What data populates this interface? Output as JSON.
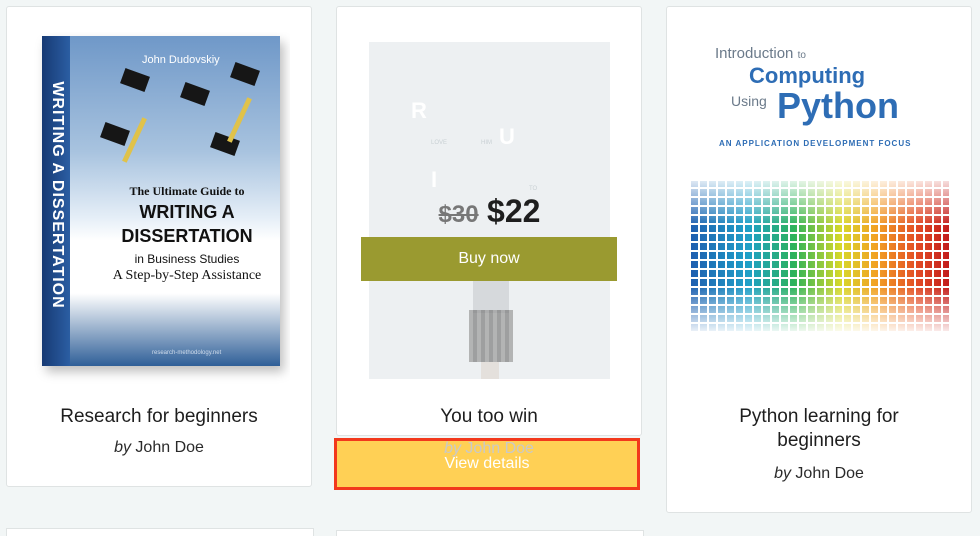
{
  "books": [
    {
      "title": "Research for beginners",
      "by": "by",
      "author": "John Doe",
      "cover": {
        "author": "John Dudovskiy",
        "spine": "WRITING A DISSERTATION",
        "line1": "The Ultimate Guide to",
        "line2": "WRITING A",
        "line3": "DISSERTATION",
        "line4": "in Business Studies",
        "line5": "A Step-by-Step Assistance",
        "url": "research-methodology.net"
      }
    },
    {
      "title": "You too win",
      "by": "by",
      "author": "John Doe",
      "old_price": "$30",
      "new_price": "$22",
      "buy_label": "Buy now",
      "details_label": "View details",
      "cover": {
        "r": "R",
        "u": "U",
        "i": "I",
        "love": "LOVE",
        "him": "HIM",
        "to": "TO"
      }
    },
    {
      "title": "Python learning for beginners",
      "by": "by",
      "author": "John Doe",
      "cover": {
        "intro": "Introduction",
        "to": "to",
        "computing": "Computing",
        "using": "Using",
        "python": "Python",
        "subtitle": "AN APPLICATION DEVELOPMENT FOCUS"
      }
    }
  ],
  "colors": {
    "buy_button": "#9a9a30",
    "details_button": "#ffd055",
    "highlight_border": "#f2381c"
  }
}
